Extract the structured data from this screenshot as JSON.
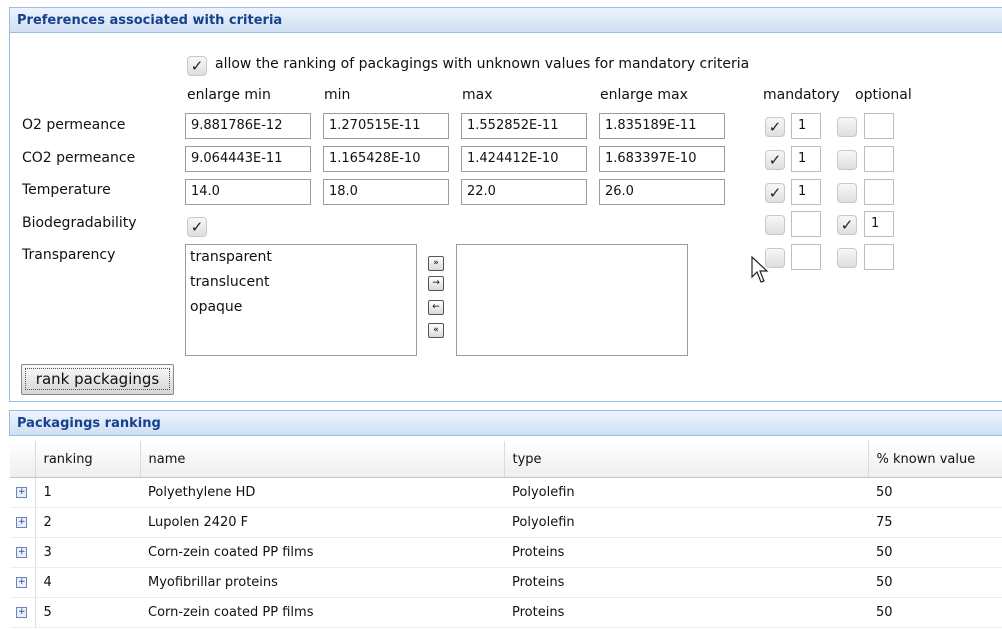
{
  "preferences": {
    "title": "Preferences associated with criteria",
    "allow_unknown": {
      "checked": true,
      "label": "allow the ranking of packagings with unknown values for mandatory criteria"
    },
    "columns": {
      "enlarge_min": "enlarge min",
      "min": "min",
      "max": "max",
      "enlarge_max": "enlarge max",
      "mandatory": "mandatory",
      "optional": "optional"
    },
    "rows": [
      {
        "label": "O2 permeance",
        "enlarge_min": "9.881786E-12",
        "min": "1.270515E-11",
        "max": "1.552852E-11",
        "enlarge_max": "1.835189E-11",
        "mandatory_checked": true,
        "mandatory_value": "1",
        "optional_checked": false,
        "optional_value": ""
      },
      {
        "label": "CO2 permeance",
        "enlarge_min": "9.064443E-11",
        "min": "1.165428E-10",
        "max": "1.424412E-10",
        "enlarge_max": "1.683397E-10",
        "mandatory_checked": true,
        "mandatory_value": "1",
        "optional_checked": false,
        "optional_value": ""
      },
      {
        "label": "Temperature",
        "enlarge_min": "14.0",
        "min": "18.0",
        "max": "22.0",
        "enlarge_max": "26.0",
        "mandatory_checked": true,
        "mandatory_value": "1",
        "optional_checked": false,
        "optional_value": ""
      },
      {
        "label": "Biodegradability",
        "value_checked": true,
        "mandatory_checked": false,
        "mandatory_value": "",
        "optional_checked": true,
        "optional_value": "1"
      },
      {
        "label": "Transparency",
        "mandatory_checked": false,
        "mandatory_value": "",
        "optional_checked": false,
        "optional_value": ""
      }
    ],
    "transparency_available": [
      "transparent",
      "translucent",
      "opaque"
    ],
    "transparency_selected": [],
    "move_buttons": {
      "add_all": "»",
      "add": "→",
      "remove": "←",
      "remove_all": "«"
    },
    "rank_button": "rank packagings"
  },
  "ranking": {
    "title": "Packagings ranking",
    "headers": {
      "ranking": "ranking",
      "name": "name",
      "type": "type",
      "known": "% known value"
    },
    "rows": [
      {
        "ranking": "1",
        "name": "Polyethylene HD",
        "type": "Polyolefin",
        "known": "50"
      },
      {
        "ranking": "2",
        "name": "Lupolen 2420 F",
        "type": "Polyolefin",
        "known": "75"
      },
      {
        "ranking": "3",
        "name": "Corn-zein coated PP films",
        "type": "Proteins",
        "known": "50"
      },
      {
        "ranking": "4",
        "name": "Myofibrillar proteins",
        "type": "Proteins",
        "known": "50"
      },
      {
        "ranking": "5",
        "name": "Corn-zein coated PP films",
        "type": "Proteins",
        "known": "50"
      }
    ],
    "expand_icon": "+"
  },
  "colors": {
    "header_text": "#15428b",
    "panel_border": "#99bbe8"
  }
}
